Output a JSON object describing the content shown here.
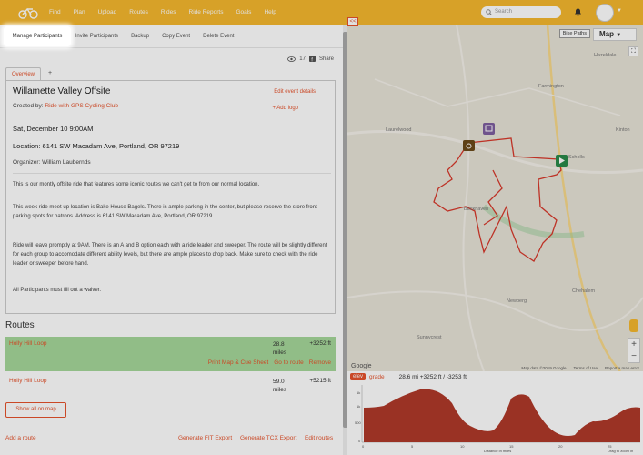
{
  "nav": {
    "items": [
      "Find",
      "Plan",
      "Upload",
      "Routes",
      "Rides",
      "Ride Reports",
      "Goals",
      "Help"
    ],
    "search_placeholder": "Search"
  },
  "subnav": {
    "items": [
      "Manage Participants",
      "Invite Participants",
      "Backup",
      "Copy Event",
      "Delete Event"
    ]
  },
  "views": {
    "count": "17",
    "share": "Share"
  },
  "tabs": {
    "overview": "Overview",
    "add": "+"
  },
  "event": {
    "title": "Willamette Valley Offsite",
    "edit": "Edit event details",
    "add_logo": "+ Add logo",
    "created_prefix": "Created by:",
    "created_by": "Ride with GPS Cycling Club",
    "date": "Sat, December 10 9:00AM",
    "location": "Location: 6141 SW Macadam Ave, Portland, OR 97219",
    "organizer": "Organizer: William Laubernds",
    "desc": [
      "This is our montly offsite ride that features some iconic routes we can't get to from our normal location.",
      "This week ride meet up location is Bake House Bagels. There is ample parking in the center, but please reserve the store front parking spots for patrons. Address is 6141 SW Macadam Ave, Portland, OR 97219",
      "Ride will leave promptly at 9AM. There is an A and B option each with a ride leader and sweeper. The route will be slightly different for each group to accomodate different ability levels, but there are ample places to drop back. Make sure to check with the ride leader or sweeper before hand.",
      "All Participants must fill out a waiver."
    ]
  },
  "routes": {
    "title": "Routes",
    "items": [
      {
        "name": "Holly Hill Loop",
        "miles": "28.8",
        "unit": "miles",
        "elev": "+3252 ft",
        "links": [
          "Print Map & Cue Sheet",
          "Go to route",
          "Remove"
        ]
      },
      {
        "name": "Holly Hill Loop",
        "miles": "59.0",
        "unit": "miles",
        "elev": "+5215 ft"
      }
    ],
    "show_all": "Show all on map",
    "add_route": "Add a route",
    "fit": "Generate FIT Export",
    "tcx": "Generate TCX Export",
    "edit": "Edit routes"
  },
  "map": {
    "collapse": "<<",
    "bike_paths": "Bike Paths",
    "type": "Map",
    "places": [
      "Hazeldale",
      "Farmington",
      "Laurelwood",
      "Kinton",
      "Buckhaven",
      "Chehalem",
      "Newberg",
      "Sunnycrest",
      "Scholls"
    ],
    "footer": [
      "Map data ©2019 Google",
      "Terms of Use",
      "Report a map error"
    ],
    "google": "Google"
  },
  "elevation": {
    "badge": "elev",
    "grade": "grade",
    "stats": "28.6 mi +3252 ft / -3253 ft",
    "y_ticks": [
      "1k",
      "1k",
      "500",
      "0"
    ],
    "x_ticks": [
      "0",
      "5",
      "10",
      "15",
      "20",
      "25"
    ],
    "x_label": "Distance in miles",
    "drag": "Drag to zoom in"
  },
  "colors": {
    "brand": "#f5b82e",
    "accent": "#e6532c",
    "route_bg": "#a6d89a",
    "elev_fill": "#b0392a"
  }
}
